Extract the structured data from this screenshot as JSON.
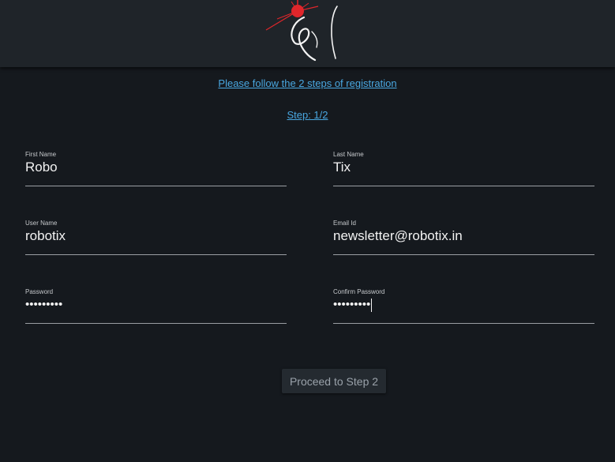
{
  "header": {
    "logo_icon": "robotix-logo"
  },
  "instruction": {
    "text": "Please follow the 2 steps of registration"
  },
  "step": {
    "text": "Step: 1/2"
  },
  "form": {
    "first_name": {
      "label": "First Name",
      "value": "Robo"
    },
    "last_name": {
      "label": "Last Name",
      "value": "Tix"
    },
    "user_name": {
      "label": "User Name",
      "value": "robotix"
    },
    "email": {
      "label": "Email Id",
      "value": "newsletter@robotix.in"
    },
    "password": {
      "label": "Password",
      "value": "•••••••••"
    },
    "confirm_password": {
      "label": "Confirm Password",
      "value": "•••••••••"
    }
  },
  "actions": {
    "proceed_label": "Proceed to Step 2"
  },
  "colors": {
    "background": "#15191e",
    "header": "#1f2429",
    "link": "#49a7e0",
    "accent_red": "#e0262b"
  }
}
